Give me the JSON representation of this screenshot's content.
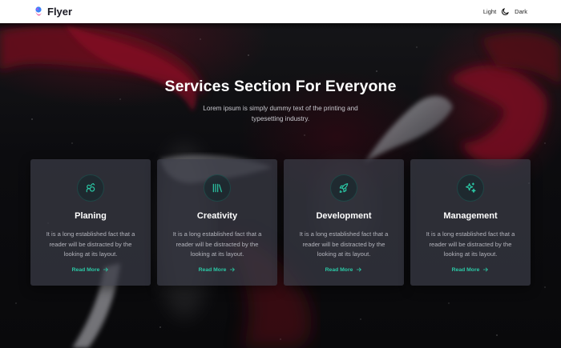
{
  "header": {
    "brand": "Flyer",
    "theme_light_label": "Light",
    "theme_dark_label": "Dark"
  },
  "hero": {
    "title": "Services Section For Everyone",
    "subtitle": "Lorem ipsum is simply dummy text of the printing and typesetting industry."
  },
  "cards": [
    {
      "title": "Planing",
      "description": "It is a long established fact that a reader will be distracted by the looking at its layout.",
      "link": "Read More",
      "icon": "planning-icon"
    },
    {
      "title": "Creativity",
      "description": "It is a long established fact that a reader will be distracted by the looking at its layout.",
      "link": "Read More",
      "icon": "creativity-icon"
    },
    {
      "title": "Development",
      "description": "It is a long established fact that a reader will be distracted by the looking at its layout.",
      "link": "Read More",
      "icon": "rocket-icon"
    },
    {
      "title": "Management",
      "description": "It is a long established fact that a reader will be distracted by the looking at its layout.",
      "link": "Read More",
      "icon": "sparkles-icon"
    }
  ],
  "colors": {
    "accent": "#2bc9a6",
    "card_bg": "#3a3c46",
    "background": "#0b0b0e"
  }
}
